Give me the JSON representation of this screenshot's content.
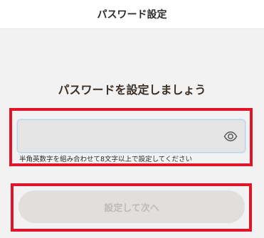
{
  "header": {
    "title": "パスワード設定"
  },
  "main": {
    "heading": "パスワードを設定しましょう",
    "password": {
      "value": "",
      "placeholder": "",
      "toggle_icon": "eye-icon"
    },
    "hint": "半角英数字を組み合わせて8文字以上で設定してください",
    "submit_label": "設定して次へ",
    "submit_disabled": true
  },
  "colors": {
    "highlight": "#e0152a",
    "button_disabled_bg": "#e1dfde",
    "button_disabled_text": "#bdbab8",
    "input_focus_border": "#b9d4e6"
  }
}
